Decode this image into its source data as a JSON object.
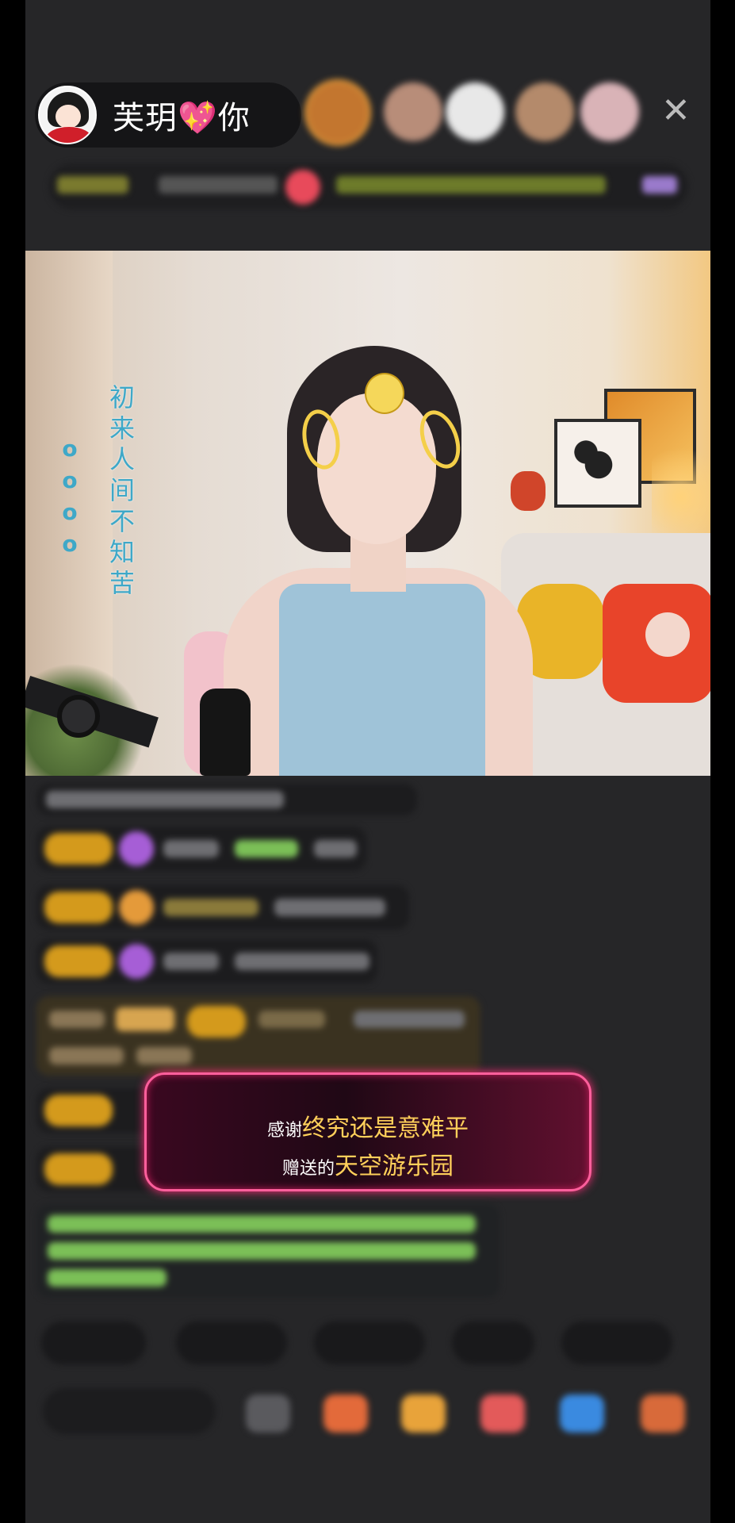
{
  "header": {
    "host_name": "芙玥💖你",
    "close_label": "✕",
    "viewer_avatars": [
      {
        "name": "viewer-1",
        "color": "#c3762f"
      },
      {
        "name": "viewer-2",
        "color": "#b88d79"
      },
      {
        "name": "viewer-3",
        "color": "#e8e8e8"
      },
      {
        "name": "viewer-4",
        "color": "#b48a6b"
      },
      {
        "name": "viewer-5",
        "color": "#d9b3b7"
      }
    ]
  },
  "video": {
    "overlay_text": "初来人间不知苦",
    "overlay_dots": "o o o o"
  },
  "gift_notice": {
    "prefix": "感谢",
    "sender": "终究还是意难平",
    "action": "赠送的",
    "gift": "天空游乐园"
  },
  "colors": {
    "accent_pink": "#ff5f9c",
    "highlight_yellow": "#ffd05a",
    "overlay_blue": "#3ea8c8",
    "badge_gold": "#d49a1c"
  },
  "icons": [
    "close-icon",
    "gift-icon",
    "game-icon",
    "share-icon",
    "more-icon"
  ]
}
